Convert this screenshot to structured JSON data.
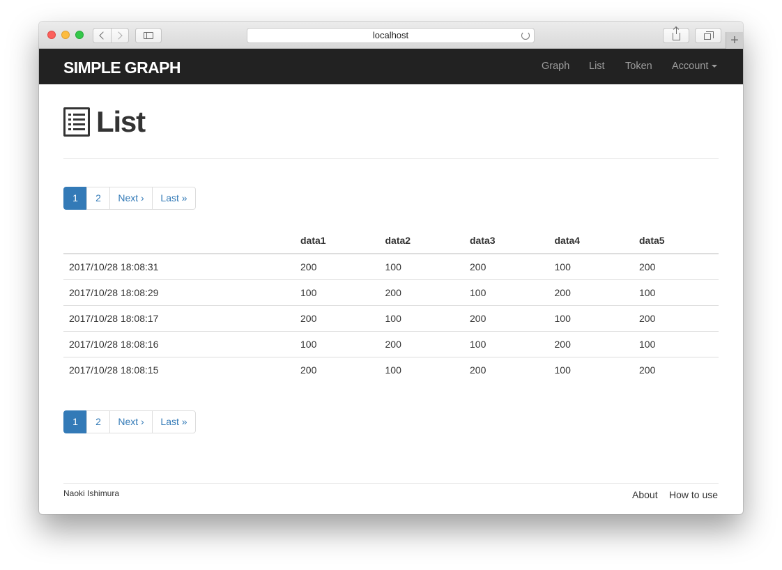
{
  "browser": {
    "url": "localhost",
    "new_tab_glyph": "+"
  },
  "navbar": {
    "brand": "SIMPLE GRAPH",
    "links": [
      {
        "label": "Graph"
      },
      {
        "label": "List"
      },
      {
        "label": "Token"
      },
      {
        "label": "Account"
      }
    ]
  },
  "page": {
    "title": "List",
    "title_icon": "list-alt-icon"
  },
  "pagination": {
    "items": [
      {
        "label": "1",
        "active": true
      },
      {
        "label": "2",
        "active": false
      },
      {
        "label": "Next ›",
        "active": false
      },
      {
        "label": "Last »",
        "active": false
      }
    ]
  },
  "table": {
    "headers": [
      "",
      "data1",
      "data2",
      "data3",
      "data4",
      "data5"
    ],
    "rows": [
      [
        "2017/10/28 18:08:31",
        "200",
        "100",
        "200",
        "100",
        "200"
      ],
      [
        "2017/10/28 18:08:29",
        "100",
        "200",
        "100",
        "200",
        "100"
      ],
      [
        "2017/10/28 18:08:17",
        "200",
        "100",
        "200",
        "100",
        "200"
      ],
      [
        "2017/10/28 18:08:16",
        "100",
        "200",
        "100",
        "200",
        "100"
      ],
      [
        "2017/10/28 18:08:15",
        "200",
        "100",
        "200",
        "100",
        "200"
      ]
    ]
  },
  "footer": {
    "author": "Naoki Ishimura",
    "links": [
      {
        "label": "About"
      },
      {
        "label": "How to use"
      }
    ]
  },
  "colors": {
    "navbar_bg": "#222222",
    "accent": "#337ab7",
    "nav_link": "#9d9d9d"
  }
}
